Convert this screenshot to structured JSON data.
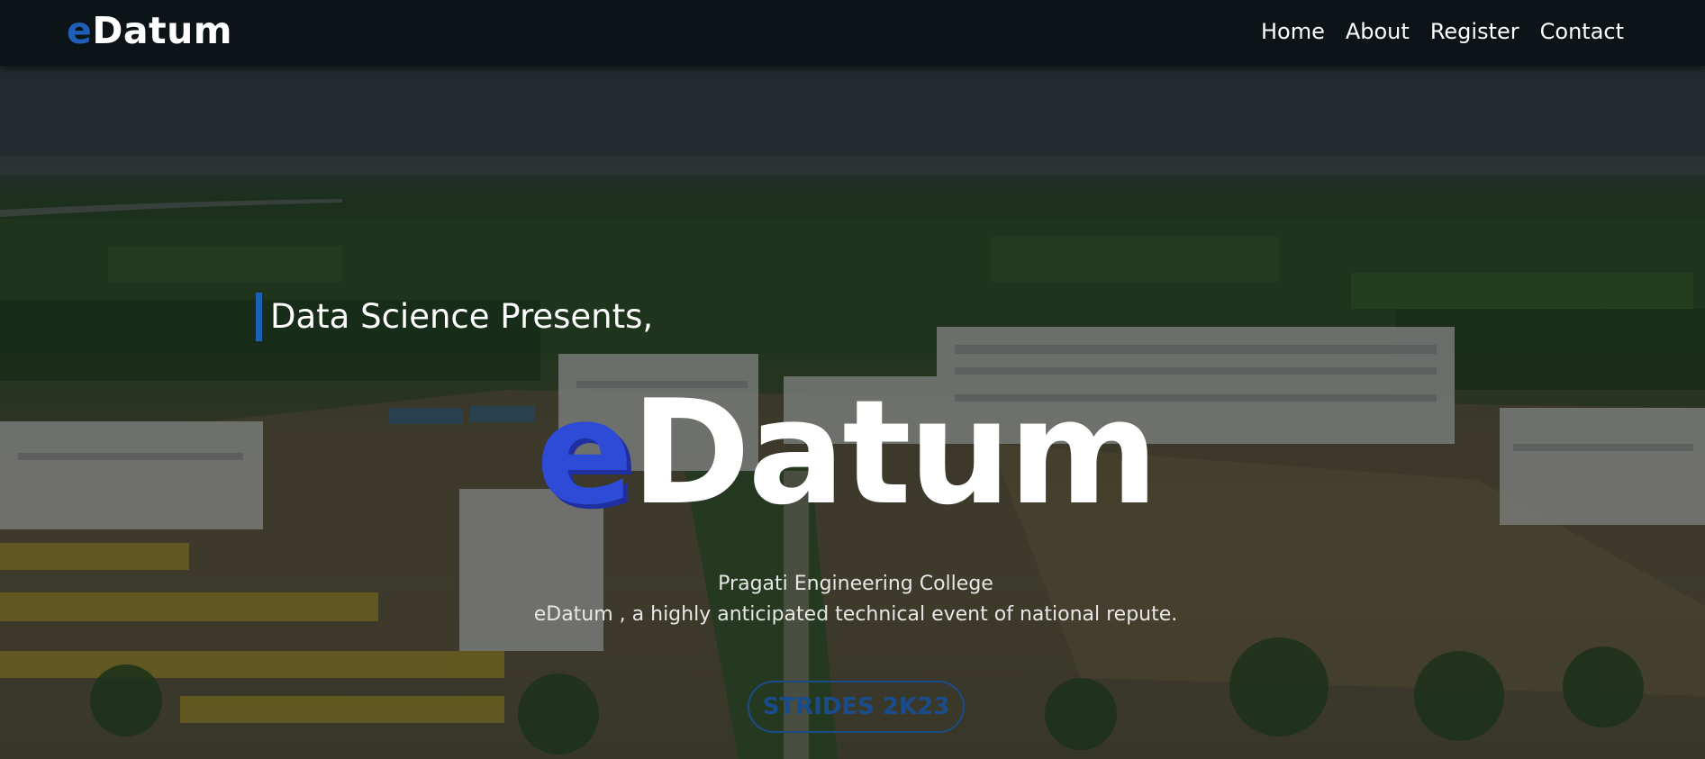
{
  "brand": {
    "prefix": "e",
    "rest": "Datum"
  },
  "nav": {
    "home": "Home",
    "about": "About",
    "register": "Register",
    "contact": "Contact"
  },
  "hero": {
    "presents": "Data Science Presents,",
    "title_prefix": "e",
    "title_rest": "Datum",
    "college": "Pragati Engineering College",
    "tagline": "eDatum , a highly anticipated technical event of national repute.",
    "cta": "STRIDES 2K23"
  },
  "colors": {
    "accent_blue": "#1f5fb8",
    "title_e": "#2e4bd8",
    "navbar_bg": "#0c1418",
    "cta_border": "#1a4c8c"
  }
}
